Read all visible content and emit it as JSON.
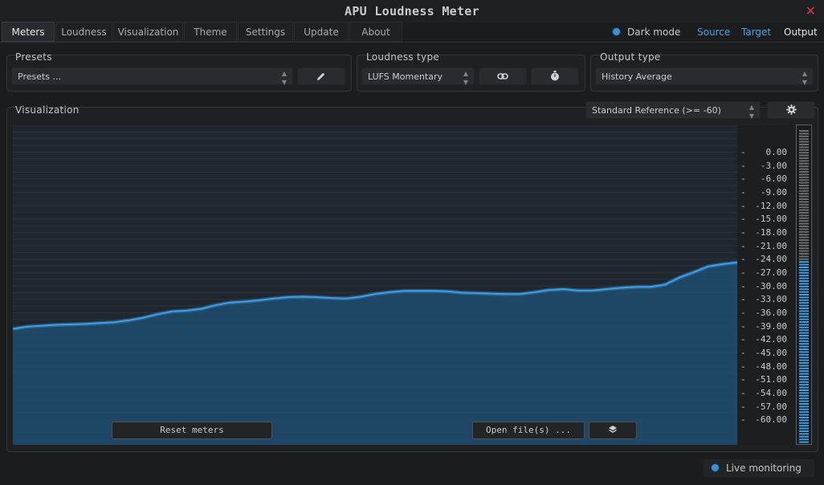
{
  "window": {
    "title": "APU Loudness Meter",
    "close_icon": "close-icon"
  },
  "tabs": [
    {
      "label": "Meters",
      "active": true
    },
    {
      "label": "Loudness"
    },
    {
      "label": "Visualization"
    },
    {
      "label": "Theme"
    },
    {
      "label": "Settings"
    },
    {
      "label": "Update"
    },
    {
      "label": "About"
    }
  ],
  "header_right": {
    "dark_mode_label": "Dark mode",
    "source_label": "Source",
    "target_label": "Target",
    "output_label": "Output",
    "active_color": "#4aa3e6"
  },
  "presets": {
    "label": "Presets",
    "value": "Presets ...",
    "edit_icon": "pencil-icon"
  },
  "loudness_type": {
    "label": "Loudness type",
    "value": "LUFS Momentary",
    "link_icon": "link-icon",
    "timer_icon": "stopwatch-icon"
  },
  "output_type": {
    "label": "Output type",
    "value": "History Average"
  },
  "visualization": {
    "label": "Visualization",
    "reference_value": "Standard Reference (>= -60)",
    "settings_icon": "gear-icon",
    "reset_label": "Reset meters",
    "open_label": "Open file(s) ...",
    "layers_icon": "layers-icon"
  },
  "scale_ticks": [
    "0.00",
    "-3.00",
    "-6.00",
    "-9.00",
    "-12.00",
    "-15.00",
    "-18.00",
    "-21.00",
    "-24.00",
    "-27.00",
    "-30.00",
    "-33.00",
    "-36.00",
    "-39.00",
    "-42.00",
    "-45.00",
    "-48.00",
    "-51.00",
    "-54.00",
    "-57.00",
    "-60.00"
  ],
  "meter_level_db": -24.5,
  "history_line_db": [
    -39.5,
    -39.0,
    -38.8,
    -38.6,
    -38.5,
    -38.4,
    -38.2,
    -38.0,
    -37.6,
    -37.0,
    -36.2,
    -35.6,
    -35.4,
    -35.0,
    -34.2,
    -33.6,
    -33.4,
    -33.1,
    -32.7,
    -32.4,
    -32.3,
    -32.4,
    -32.6,
    -32.7,
    -32.3,
    -31.7,
    -31.3,
    -31.0,
    -31.0,
    -31.0,
    -31.1,
    -31.4,
    -31.5,
    -31.6,
    -31.7,
    -31.7,
    -31.3,
    -30.8,
    -30.6,
    -30.9,
    -30.9,
    -30.6,
    -30.3,
    -30.1,
    -30.1,
    -29.6,
    -28.0,
    -26.8,
    -25.5,
    -25.0,
    -24.6
  ],
  "plot_colors": {
    "line": "#3f9ee6",
    "fill": "#1f4e70"
  },
  "live_monitoring": {
    "label": "Live monitoring"
  }
}
